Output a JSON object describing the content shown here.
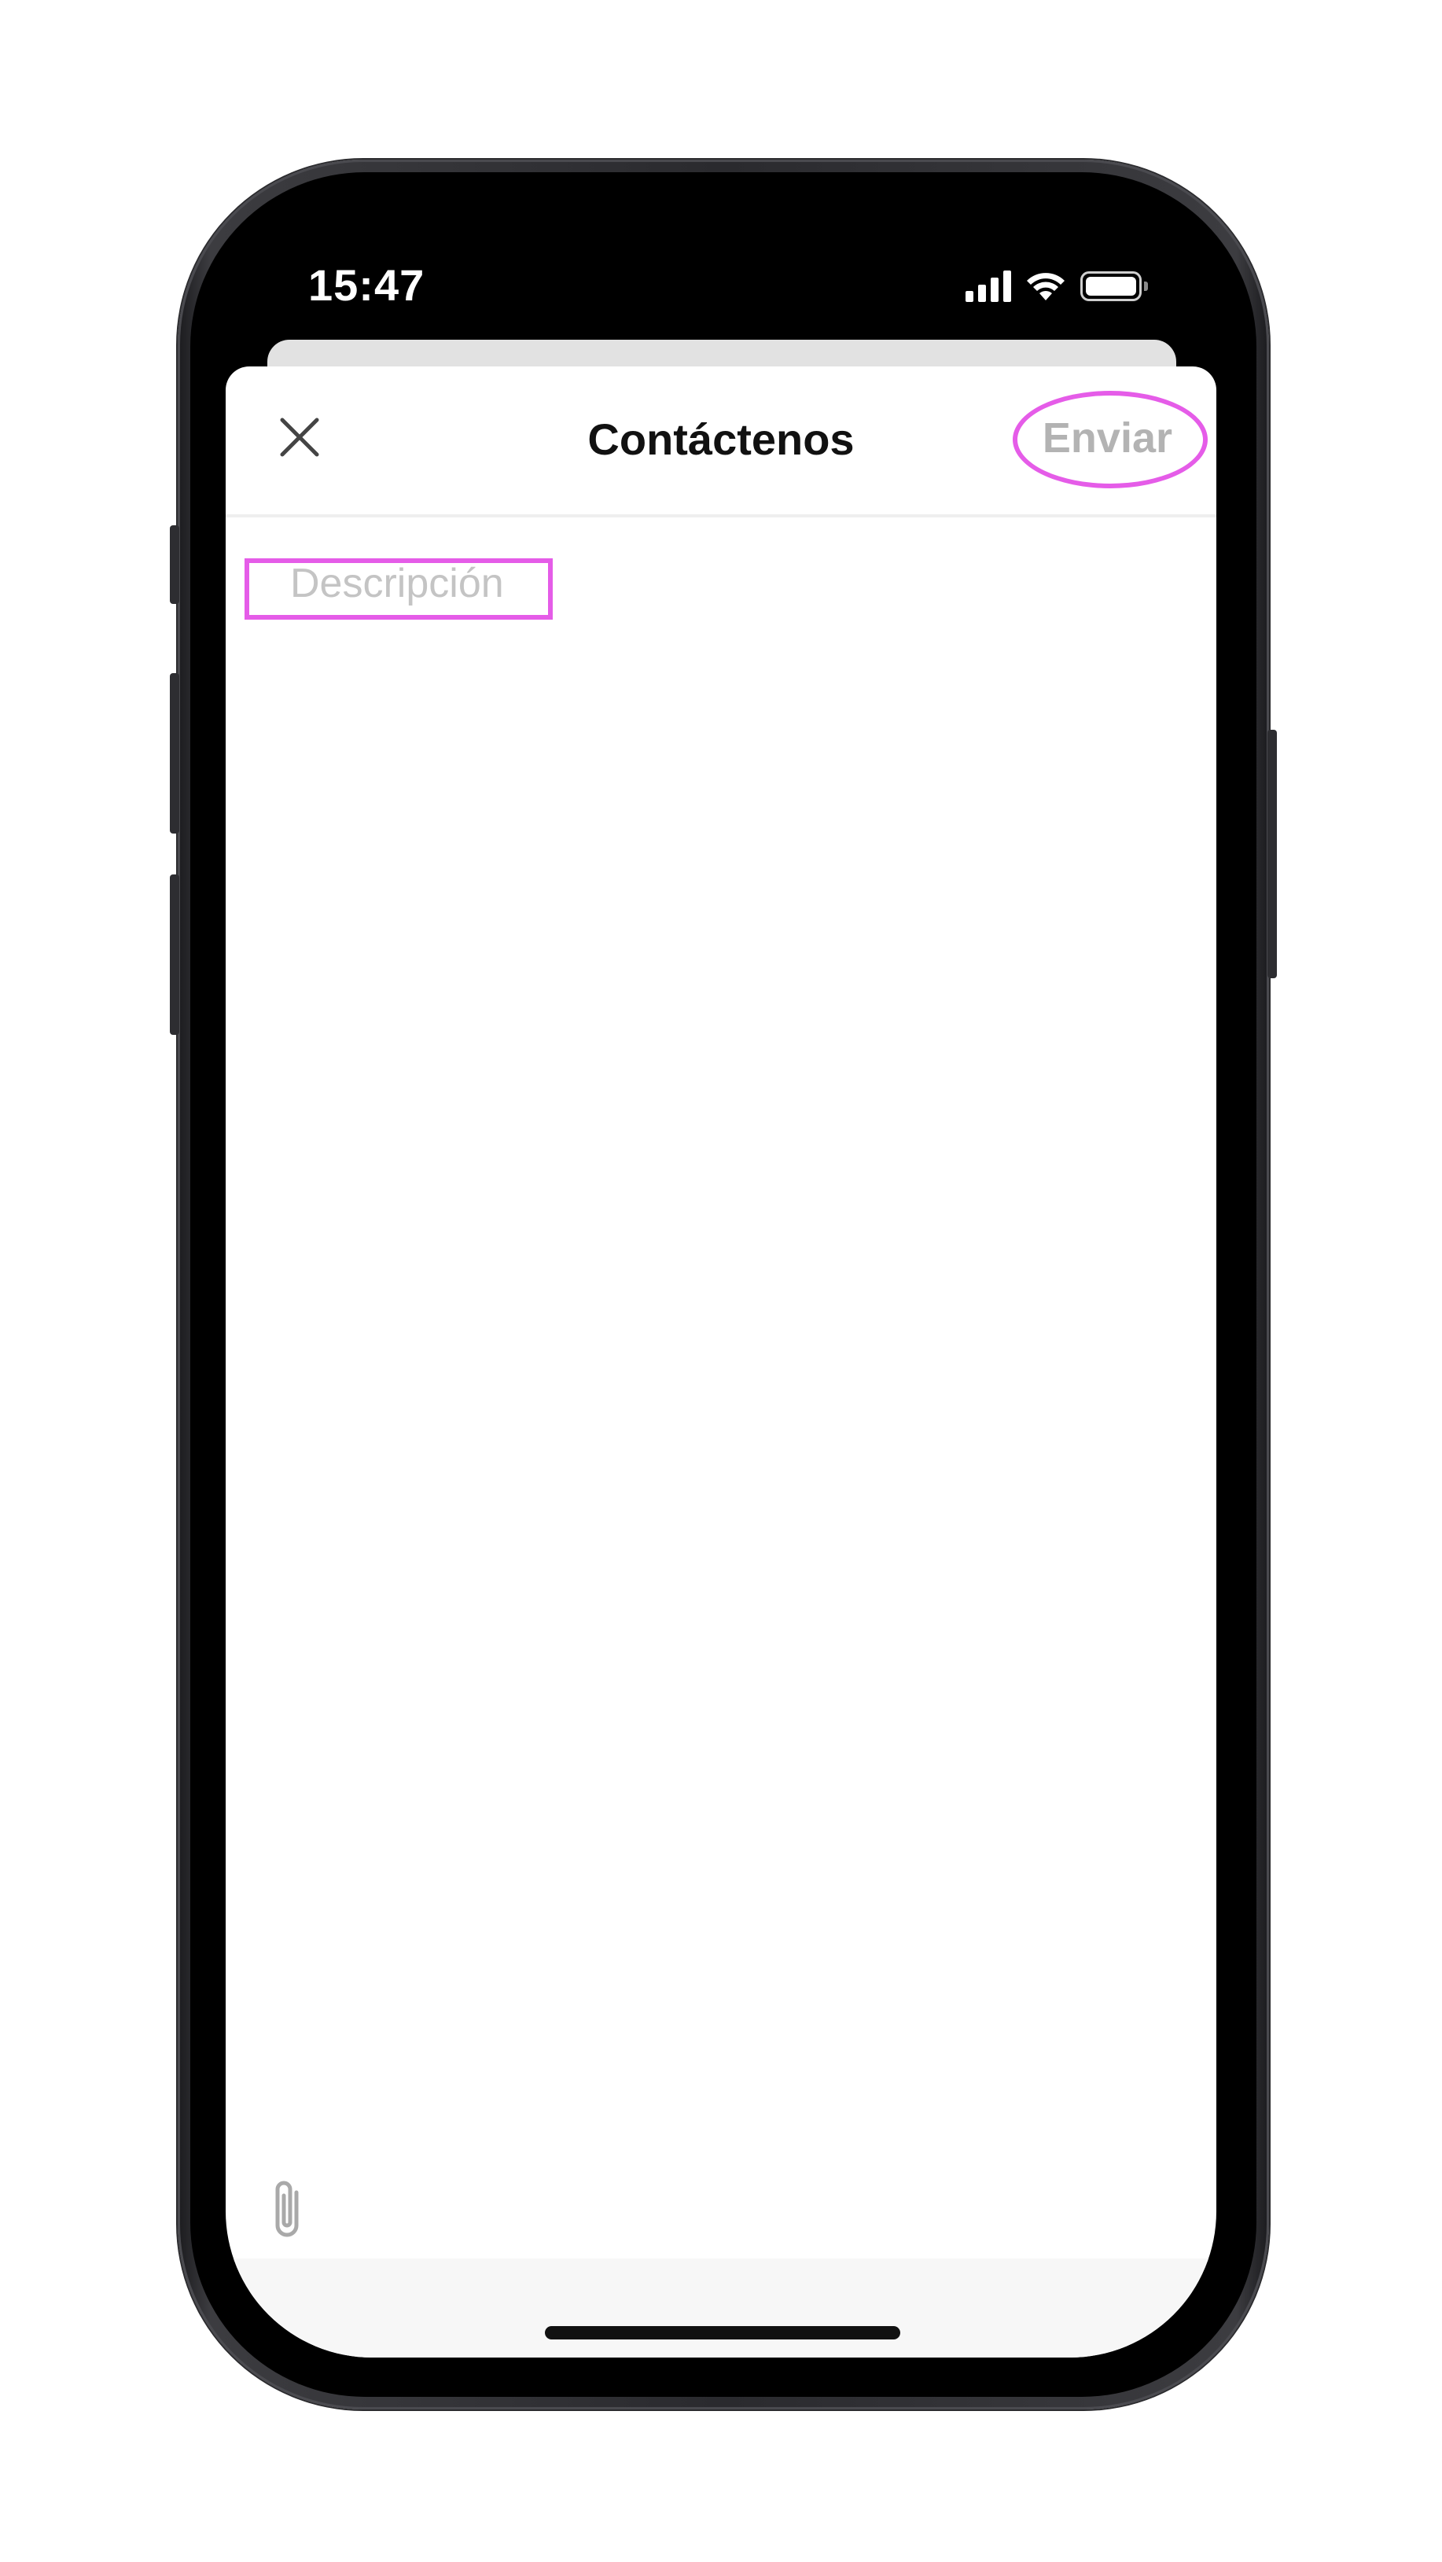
{
  "status_bar": {
    "time": "15:47",
    "icons": [
      "signal-icon",
      "wifi-icon",
      "battery-icon"
    ]
  },
  "sheet": {
    "title": "Contáctenos",
    "close_icon": "close-icon",
    "send_label": "Enviar",
    "description_placeholder": "Descripción",
    "description_value": "",
    "attach_icon": "paperclip-icon"
  },
  "colors": {
    "highlight": "#e55ce8",
    "send_disabled": "#b3b3b3",
    "placeholder": "#c4c4c4",
    "title": "#111111"
  }
}
